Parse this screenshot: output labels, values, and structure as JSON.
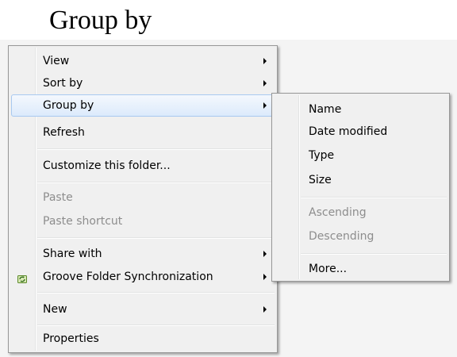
{
  "heading": "Group by",
  "context_menu": {
    "items": [
      {
        "label": "View"
      },
      {
        "label": "Sort by"
      },
      {
        "label": "Group by"
      },
      {
        "label": "Refresh"
      },
      {
        "label": "Customize this folder..."
      },
      {
        "label": "Paste"
      },
      {
        "label": "Paste shortcut"
      },
      {
        "label": "Share with"
      },
      {
        "label": "Groove Folder Synchronization"
      },
      {
        "label": "New"
      },
      {
        "label": "Properties"
      }
    ]
  },
  "group_by_submenu": {
    "items": [
      {
        "label": "Name"
      },
      {
        "label": "Date modified"
      },
      {
        "label": "Type"
      },
      {
        "label": "Size"
      },
      {
        "label": "Ascending"
      },
      {
        "label": "Descending"
      },
      {
        "label": "More..."
      }
    ]
  },
  "icons": {
    "groove": "groove-sync-icon",
    "submenu_arrow": "chevron-right-icon"
  },
  "colors": {
    "menu_bg": "#f0f0f0",
    "highlight": "#dceafc",
    "highlight_border": "#a8c9f0",
    "disabled_text": "#8d8d8d"
  }
}
